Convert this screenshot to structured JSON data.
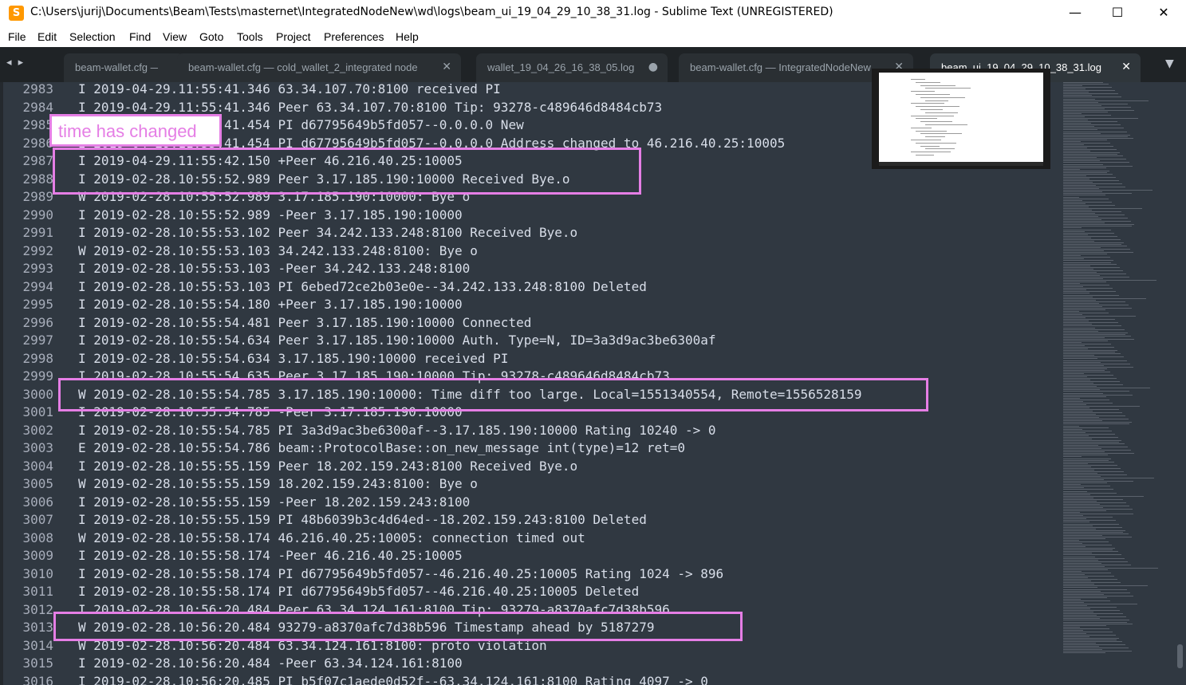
{
  "window": {
    "title": "C:\\Users\\jurij\\Documents\\Beam\\Tests\\masternet\\IntegratedNodeNew\\wd\\logs\\beam_ui_19_04_29_10_38_31.log - Sublime Text (UNREGISTERED)",
    "app_icon": "sublime-text-icon",
    "minimize": "—",
    "maximize": "☐",
    "close": "✕"
  },
  "menu": [
    "File",
    "Edit",
    "Selection",
    "Find",
    "View",
    "Goto",
    "Tools",
    "Project",
    "Preferences",
    "Help"
  ],
  "tabs": {
    "nav": "◂ ▸",
    "overflow": "▼",
    "items": [
      {
        "label": "beam-wallet.cfg — F",
        "close": ""
      },
      {
        "label": "beam-wallet.cfg — cold_wallet_2_integrated node",
        "close": "✕"
      },
      {
        "label": "wallet_19_04_26_16_38_05.log",
        "close": "●"
      },
      {
        "label": "beam-wallet.cfg — IntegratedNodeNew",
        "close": "✕"
      },
      {
        "label": "beam_ui_19_04_29_10_38_31.log",
        "close": "✕"
      }
    ]
  },
  "annotation_note": "time has changed",
  "lines": [
    {
      "n": "2983",
      "text": "I 2019-04-29.11:55:41.346 63.34.107.70:8100 received PI"
    },
    {
      "n": "2984",
      "text": "I 2019-04-29.11:55:41.346 Peer 63.34.107.70:8100 Tip: 93278-c489646d8484cb73"
    },
    {
      "n": "2985",
      "text": "I 2019-04-29.11:55:41.454 PI d67795649b5fd057--0.0.0.0 New"
    },
    {
      "n": "2986",
      "text": "I 2019-04-29.11:55:41.454 PI d67795649b5fd057--0.0.0.0 Address changed to 46.216.40.25:10005"
    },
    {
      "n": "2987",
      "text": "I 2019-04-29.11:55:42.150 +Peer 46.216.40.25:10005"
    },
    {
      "n": "2988",
      "text": "I 2019-02-28.10:55:52.989 Peer 3.17.185.190:10000 Received Bye.o"
    },
    {
      "n": "2989",
      "text": "W 2019-02-28.10:55:52.989 3.17.185.190:10000: Bye o"
    },
    {
      "n": "2990",
      "text": "I 2019-02-28.10:55:52.989 -Peer 3.17.185.190:10000"
    },
    {
      "n": "2991",
      "text": "I 2019-02-28.10:55:53.102 Peer 34.242.133.248:8100 Received Bye.o"
    },
    {
      "n": "2992",
      "text": "W 2019-02-28.10:55:53.103 34.242.133.248:8100: Bye o"
    },
    {
      "n": "2993",
      "text": "I 2019-02-28.10:55:53.103 -Peer 34.242.133.248:8100"
    },
    {
      "n": "2994",
      "text": "I 2019-02-28.10:55:53.103 PI 6ebed72ce2b03e0e--34.242.133.248:8100 Deleted"
    },
    {
      "n": "2995",
      "text": "I 2019-02-28.10:55:54.180 +Peer 3.17.185.190:10000"
    },
    {
      "n": "2996",
      "text": "I 2019-02-28.10:55:54.481 Peer 3.17.185.190:10000 Connected"
    },
    {
      "n": "2997",
      "text": "I 2019-02-28.10:55:54.634 Peer 3.17.185.190:10000 Auth. Type=N, ID=3a3d9ac3be6300af"
    },
    {
      "n": "2998",
      "text": "I 2019-02-28.10:55:54.634 3.17.185.190:10000 received PI"
    },
    {
      "n": "2999",
      "text": "I 2019-02-28.10:55:54.635 Peer 3.17.185.190:10000 Tip: 93278-c489646d8484cb73"
    },
    {
      "n": "3000",
      "text": "W 2019-02-28.10:55:54.785 3.17.185.190:10000: Time diff too large. Local=1551340554, Remote=1556528159"
    },
    {
      "n": "3001",
      "text": "I 2019-02-28.10:55:54.785 -Peer 3.17.185.190:10000"
    },
    {
      "n": "3002",
      "text": "I 2019-02-28.10:55:54.785 PI 3a3d9ac3be6300af--3.17.185.190:10000 Rating 10240 -> 0"
    },
    {
      "n": "3003",
      "text": "E 2019-02-28.10:55:54.786 beam::ProtocolBase::on_new_message int(type)=12 ret=0"
    },
    {
      "n": "3004",
      "text": "I 2019-02-28.10:55:55.159 Peer 18.202.159.243:8100 Received Bye.o"
    },
    {
      "n": "3005",
      "text": "W 2019-02-28.10:55:55.159 18.202.159.243:8100: Bye o"
    },
    {
      "n": "3006",
      "text": "I 2019-02-28.10:55:55.159 -Peer 18.202.159.243:8100"
    },
    {
      "n": "3007",
      "text": "I 2019-02-28.10:55:55.159 PI 48b6039b3c4d64ed--18.202.159.243:8100 Deleted"
    },
    {
      "n": "3008",
      "text": "W 2019-02-28.10:55:58.174 46.216.40.25:10005: connection timed out"
    },
    {
      "n": "3009",
      "text": "I 2019-02-28.10:55:58.174 -Peer 46.216.40.25:10005"
    },
    {
      "n": "3010",
      "text": "I 2019-02-28.10:55:58.174 PI d67795649b5fd057--46.216.40.25:10005 Rating 1024 -> 896"
    },
    {
      "n": "3011",
      "text": "I 2019-02-28.10:55:58.174 PI d67795649b5fd057--46.216.40.25:10005 Deleted"
    },
    {
      "n": "3012",
      "text": "I 2019-02-28.10:56:20.484 Peer 63.34.124.161:8100 Tip: 93279-a8370afc7d38b596"
    },
    {
      "n": "3013",
      "text": "W 2019-02-28.10:56:20.484 93279-a8370afc7d38b596 Timestamp ahead by 5187279"
    },
    {
      "n": "3014",
      "text": "W 2019-02-28.10:56:20.484 63.34.124.161:8100: proto violation"
    },
    {
      "n": "3015",
      "text": "I 2019-02-28.10:56:20.484 -Peer 63.34.124.161:8100"
    },
    {
      "n": "3016",
      "text": "I 2019-02-28.10:56:20.485 PI b5f07c1aede0d52f--63.34.124.161:8100 Rating 4097 -> 0"
    }
  ],
  "colors": {
    "editor_bg": "#303841",
    "text": "#d8dee9",
    "line_numbers": "#a7adba",
    "annotation": "#e57ee5"
  }
}
